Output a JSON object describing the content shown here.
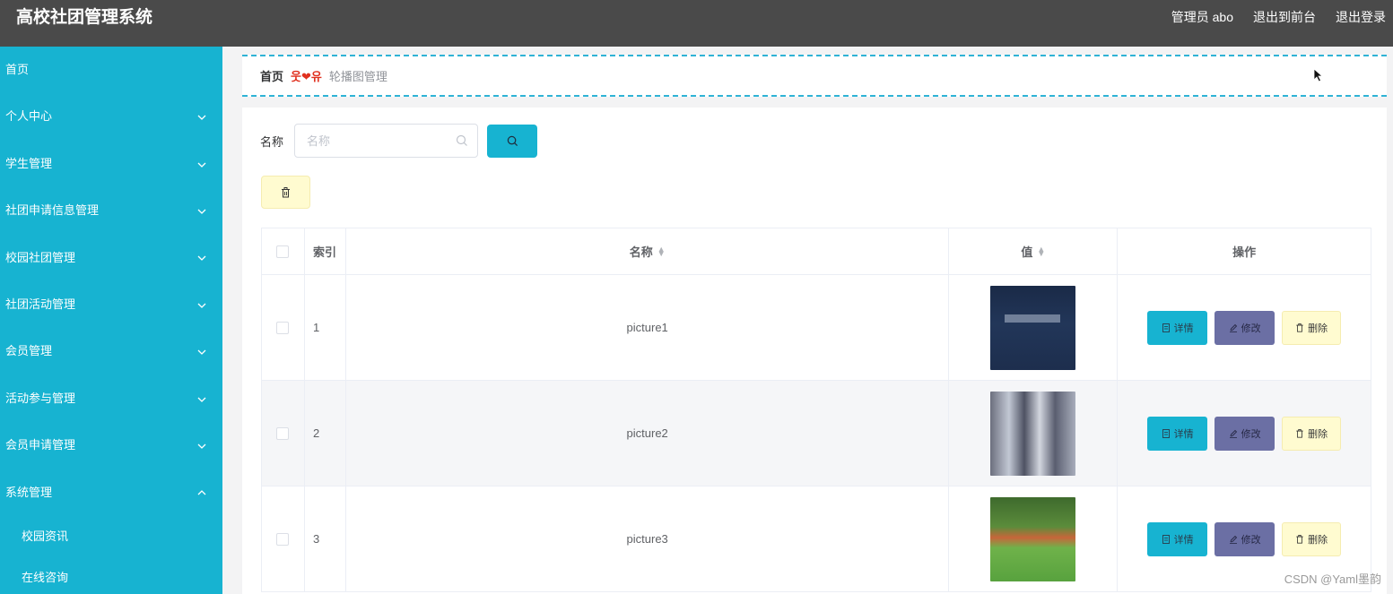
{
  "app": {
    "title": "高校社团管理系统",
    "top_links": [
      "管理员 abo",
      "退出到前台",
      "退出登录"
    ]
  },
  "sidebar": {
    "items": [
      {
        "label": "首页",
        "has_arrow": false
      },
      {
        "label": "个人中心",
        "has_arrow": true,
        "arrow": "chevron-down-icon"
      },
      {
        "label": "学生管理",
        "has_arrow": true,
        "arrow": "chevron-down-icon"
      },
      {
        "label": "社团申请信息管理",
        "has_arrow": true,
        "arrow": "chevron-down-icon"
      },
      {
        "label": "校园社团管理",
        "has_arrow": true,
        "arrow": "chevron-down-icon"
      },
      {
        "label": "社团活动管理",
        "has_arrow": true,
        "arrow": "chevron-down-icon"
      },
      {
        "label": "会员管理",
        "has_arrow": true,
        "arrow": "chevron-down-icon"
      },
      {
        "label": "活动参与管理",
        "has_arrow": true,
        "arrow": "chevron-down-icon"
      },
      {
        "label": "会员申请管理",
        "has_arrow": true,
        "arrow": "chevron-down-icon"
      },
      {
        "label": "系统管理",
        "has_arrow": true,
        "arrow": "chevron-up-icon"
      }
    ],
    "sub_items": [
      "校园资讯",
      "在线咨询"
    ],
    "bg_color": "#17b3d1"
  },
  "breadcrumb": {
    "home": "首页",
    "separator": "웃❤유",
    "current": "轮播图管理"
  },
  "search": {
    "label": "名称",
    "placeholder": "名称",
    "value": ""
  },
  "table": {
    "headers": {
      "index": "索引",
      "name": "名称",
      "value": "值",
      "ops": "操作"
    },
    "rows": [
      {
        "index": "1",
        "name": "picture1",
        "image": "dark navy banner with blurred white text"
      },
      {
        "index": "2",
        "name": "picture2",
        "image": "blurred gray city buildings"
      },
      {
        "index": "3",
        "name": "picture3",
        "image": "green campus lawn with trees"
      }
    ],
    "actions": {
      "detail": "详情",
      "edit": "修改",
      "delete": "删除"
    }
  },
  "colors": {
    "primary": "#17b3d1",
    "edit": "#6b6fa4",
    "delete_bg": "#fffbd0",
    "topbar": "#4a4a4a"
  },
  "watermark": "CSDN @Yaml墨韵"
}
